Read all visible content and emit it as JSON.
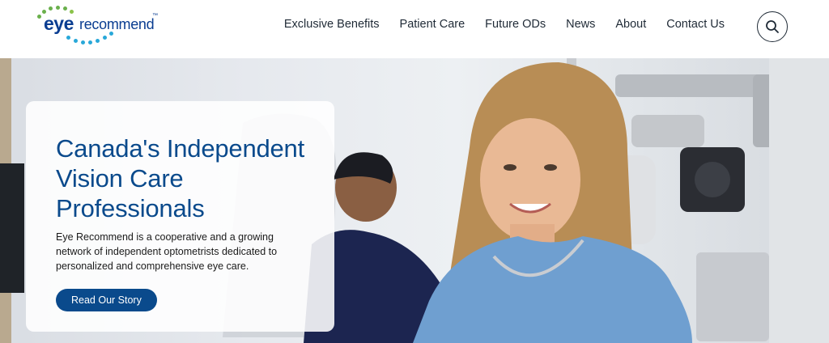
{
  "brand": {
    "logo_primary": "eye",
    "logo_secondary": "recommend",
    "logo_mark": "™"
  },
  "nav": {
    "items": [
      {
        "label": "Exclusive Benefits"
      },
      {
        "label": "Patient Care"
      },
      {
        "label": "Future ODs"
      },
      {
        "label": "News"
      },
      {
        "label": "About"
      },
      {
        "label": "Contact Us"
      }
    ],
    "search_icon": "search-icon"
  },
  "hero": {
    "title": "Canada's Independent Vision Care Professionals",
    "description": "Eye Recommend is a cooperative and a growing network of independent optometrists dedicated to personalized and comprehensive eye care.",
    "cta_label": "Read Our Story"
  },
  "colors": {
    "brand_blue": "#0a4a8c",
    "logo_green": "#6ab04c",
    "logo_cyan": "#29a8d9",
    "text_dark": "#1f2a36"
  }
}
